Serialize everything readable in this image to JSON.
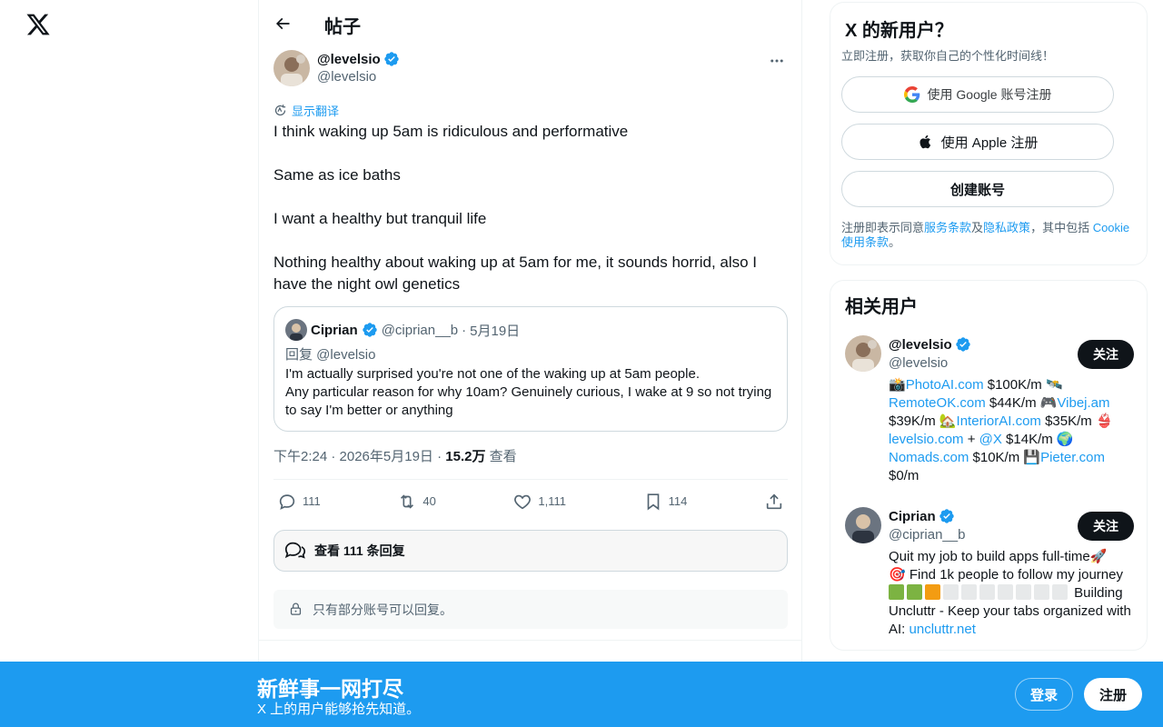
{
  "header": {
    "title": "帖子"
  },
  "post": {
    "author_name": "@levelsio",
    "author_handle": "@levelsio",
    "translate_label": "显示翻译",
    "paragraphs": [
      "I think waking up 5am is ridiculous and performative",
      "Same as ice baths",
      "I want a healthy but tranquil life",
      "Nothing healthy about waking up at 5am for me, it sounds horrid, also I have the night owl genetics"
    ],
    "quote": {
      "name": "Ciprian",
      "handle": "@ciprian__b",
      "separator": "·",
      "date": "5月19日",
      "reply_to": "回复 @levelsio",
      "line1": "I'm actually surprised you're not one of the waking up at 5am people.",
      "line2": "Any particular reason for why 10am? Genuinely curious, I wake at 9 so not trying to say I'm better or anything"
    },
    "meta": {
      "time": "下午2:24 · 2026年5月19日 · ",
      "views_count": "15.2万",
      "views_label": " 查看"
    },
    "actions": {
      "replies": "111",
      "reposts": "40",
      "likes": "1,111",
      "bookmarks": "114"
    },
    "view_replies_label": "查看 111 条回复",
    "restricted_label": "只有部分账号可以回复。"
  },
  "signup_card": {
    "title": "X 的新用户？",
    "subtitle": "立即注册，获取你自己的个性化时间线！",
    "google_label": "使用 Google 账号注册",
    "apple_label": "使用 Apple 注册",
    "create_label": "创建账号",
    "terms_prefix": "注册即表示同意",
    "terms_link": "服务条款",
    "and": "及",
    "privacy_link": "隐私政策",
    "including": "，其中包括 ",
    "cookie_link": "Cookie 使用条款",
    "period": "。"
  },
  "related": {
    "title": "相关用户",
    "follow_label": "关注",
    "users": [
      {
        "name": "@levelsio",
        "handle": "@levelsio",
        "bio": {
          "e1": "📸",
          "l1": "PhotoAI.com",
          "t1": " $100K/m 🛰️",
          "l2": "RemoteOK.com",
          "t2": " $44K/m 🎮",
          "l3": "Vibej.am",
          "t3": " $39K/m 🏡",
          "l4": "InteriorAI.com",
          "t4": " $35K/m 👙",
          "l5": "levelsio.com",
          "t5": " + ",
          "l6": "@X",
          "t6": " $14K/m 🌍",
          "l7": "Nomads.com",
          "t7": " $10K/m 💾",
          "l8": "Pieter.com",
          "t8": " $0/m"
        }
      },
      {
        "name": "Ciprian",
        "handle": "@ciprian__b",
        "bio": {
          "line1": "Quit my job to build apps full-time🚀",
          "line2": "🎯 Find 1k people to follow my journey",
          "progress_done": 3,
          "progress_total": 10,
          "line3": " Building Uncluttr - Keep your tabs organized with AI: ",
          "link": "uncluttr.net"
        }
      }
    ]
  },
  "bottom_bar": {
    "title": "新鲜事一网打尽",
    "subtitle": "X 上的用户能够抢先知道。",
    "login_label": "登录",
    "signup_label": "注册"
  },
  "colors": {
    "accent": "#1d9bf0",
    "text": "#0f1419",
    "muted": "#536471",
    "border": "#cfd9de"
  }
}
